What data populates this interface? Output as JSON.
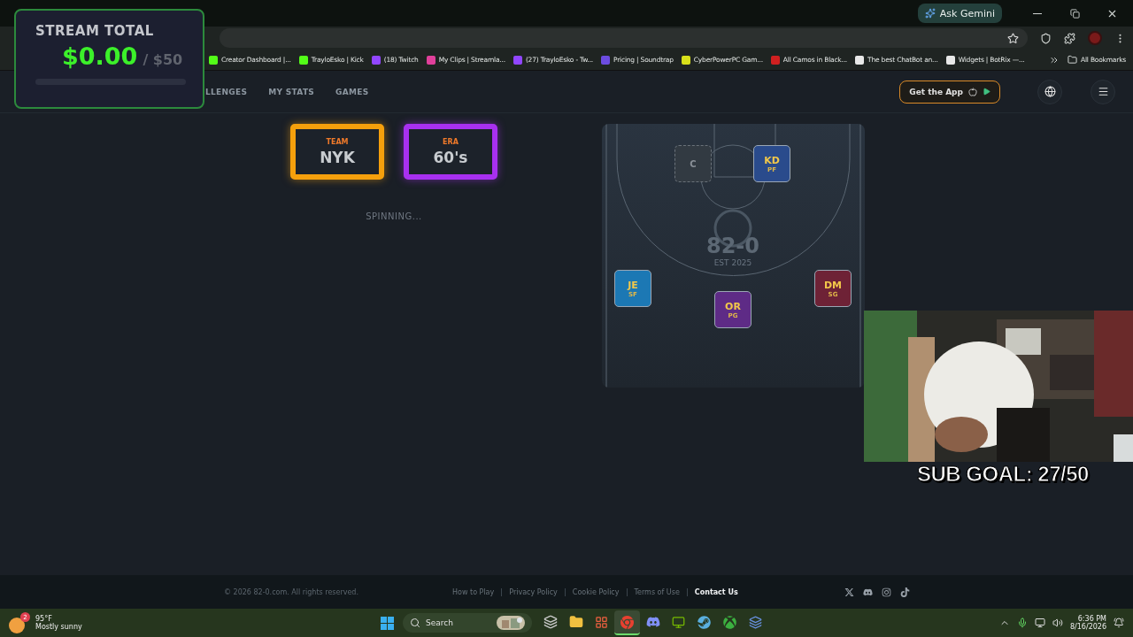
{
  "browser": {
    "ask_gemini": "Ask Gemini",
    "bookmarks": [
      {
        "label": "Creator Dashboard |...",
        "color": "#53fc18"
      },
      {
        "label": "TrayloEsko | Kick",
        "color": "#53fc18"
      },
      {
        "label": "(18) Twitch",
        "color": "#9146ff"
      },
      {
        "label": "My Clips | Streamla...",
        "color": "#e0409a"
      },
      {
        "label": "(27) TrayloEsko - Tw...",
        "color": "#9146ff"
      },
      {
        "label": "Pricing | Soundtrap",
        "color": "#6c4ce0"
      },
      {
        "label": "CyberPowerPC Gam...",
        "color": "#d8e01a"
      },
      {
        "label": "All Camos in Black...",
        "color": "#d02020"
      },
      {
        "label": "The best ChatBot an...",
        "color": "#e8e8e8"
      },
      {
        "label": "Widgets | BotRix —...",
        "color": "#e8e8e8"
      }
    ],
    "all_bookmarks": "All Bookmarks"
  },
  "stream_overlay": {
    "title": "STREAM TOTAL",
    "amount": "$0.00",
    "goal": "/ $50",
    "level": 0
  },
  "nav": {
    "items": [
      {
        "label": "LLENGES"
      },
      {
        "label": "MY STATS"
      },
      {
        "label": "GAMES"
      }
    ],
    "get_app": "Get the App"
  },
  "spin": [
    {
      "label": "TEAM",
      "value": "NYK",
      "color": "#f5a00c"
    },
    {
      "label": "ERA",
      "value": "60's",
      "color": "#a830f0"
    }
  ],
  "status": "SPINNING...",
  "court": {
    "logo": "82-0",
    "logo_sub": "EST 2025",
    "players": [
      {
        "kind": "empty",
        "initials": "C"
      },
      {
        "kind": "player",
        "initials": "KD",
        "position": "PF",
        "color": "#2a4b8c"
      },
      {
        "kind": "player",
        "initials": "JE",
        "position": "SF",
        "color": "#1c78b4"
      },
      {
        "kind": "player",
        "initials": "OR",
        "position": "PG",
        "color": "#5e2b86"
      },
      {
        "kind": "player",
        "initials": "DM",
        "position": "SG",
        "color": "#6e2236"
      }
    ]
  },
  "sub_goal": "SUB GOAL: 27/50",
  "footer": {
    "copyright": "© 2026 82-0.com. All rights reserved.",
    "links": [
      {
        "label": "How to Play",
        "bold": false
      },
      {
        "label": "Privacy Policy",
        "bold": false
      },
      {
        "label": "Cookie Policy",
        "bold": false
      },
      {
        "label": "Terms of Use",
        "bold": false
      },
      {
        "label": "Contact Us",
        "bold": true
      }
    ]
  },
  "taskbar": {
    "temperature": "95°F",
    "weather": "Mostly sunny",
    "badge": "2",
    "search": "Search",
    "apps": [
      {
        "kind": "files",
        "active": false
      },
      {
        "kind": "folder",
        "active": false
      },
      {
        "kind": "store",
        "active": false
      },
      {
        "kind": "chrome",
        "active": true
      },
      {
        "kind": "discord",
        "active": false
      },
      {
        "kind": "nvidia",
        "active": false
      },
      {
        "kind": "steam",
        "active": false
      },
      {
        "kind": "xbox",
        "active": false
      },
      {
        "kind": "network",
        "active": false
      }
    ],
    "time": "6:36 PM",
    "date": "8/16/2026"
  }
}
